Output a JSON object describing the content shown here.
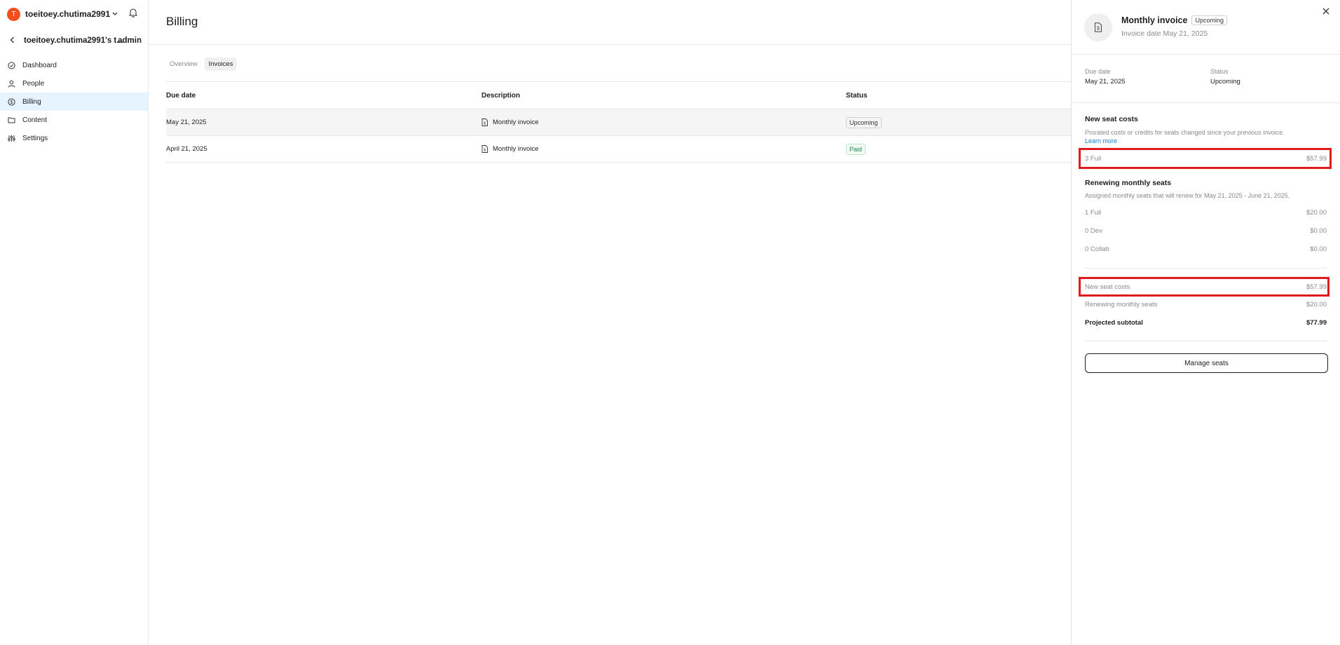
{
  "sidebar": {
    "avatar_letter": "T",
    "user_name": "toeitoey.chutima2991",
    "team_name": "toeitoey.chutima2991's t...",
    "team_role": "admin",
    "items": [
      {
        "label": "Dashboard",
        "icon": "dashboard-icon"
      },
      {
        "label": "People",
        "icon": "person-icon"
      },
      {
        "label": "Billing",
        "icon": "dollar-icon"
      },
      {
        "label": "Content",
        "icon": "folder-icon"
      },
      {
        "label": "Settings",
        "icon": "sliders-icon"
      }
    ],
    "active_item": "Billing"
  },
  "main": {
    "title": "Billing",
    "tabs": [
      {
        "label": "Overview"
      },
      {
        "label": "Invoices"
      }
    ],
    "active_tab": "Invoices",
    "table": {
      "headers": {
        "due_date": "Due date",
        "description": "Description",
        "status": "Status"
      },
      "rows": [
        {
          "due_date": "May 21, 2025",
          "description": "Monthly invoice",
          "status": "Upcoming"
        },
        {
          "due_date": "April 21, 2025",
          "description": "Monthly invoice",
          "status": "Paid"
        }
      ]
    }
  },
  "panel": {
    "title": "Monthly invoice",
    "badge": "Upcoming",
    "invoice_date": "Invoice date May 21, 2025",
    "due_date_label": "Due date",
    "due_date_value": "May 21, 2025",
    "status_label": "Status",
    "status_value": "Upcoming",
    "new_seat": {
      "title": "New seat costs",
      "description": "Prorated costs or credits for seats changed since your previous invoice.",
      "learn_more": "Learn more",
      "line": {
        "label": "3 Full",
        "amount": "$57.99"
      }
    },
    "renewing": {
      "title": "Renewing monthly seats",
      "description": "Assigned monthly seats that will renew for May 21, 2025 - June 21, 2025.",
      "lines": [
        {
          "label": "1 Full",
          "amount": "$20.00"
        },
        {
          "label": "0 Dev",
          "amount": "$0.00"
        },
        {
          "label": "0 Collab",
          "amount": "$0.00"
        }
      ]
    },
    "summary": {
      "new_seat_label": "New seat costs",
      "new_seat_amount": "$57.99",
      "renewing_label": "Renewing monthly seats",
      "renewing_amount": "$20.00",
      "subtotal_label": "Projected subtotal",
      "subtotal_amount": "$77.99"
    },
    "manage_button": "Manage seats"
  },
  "colors": {
    "avatar": "#f24e1e",
    "active_nav": "#e5f4ff",
    "link": "#0d7fd0",
    "highlight": "#e01b1b"
  }
}
